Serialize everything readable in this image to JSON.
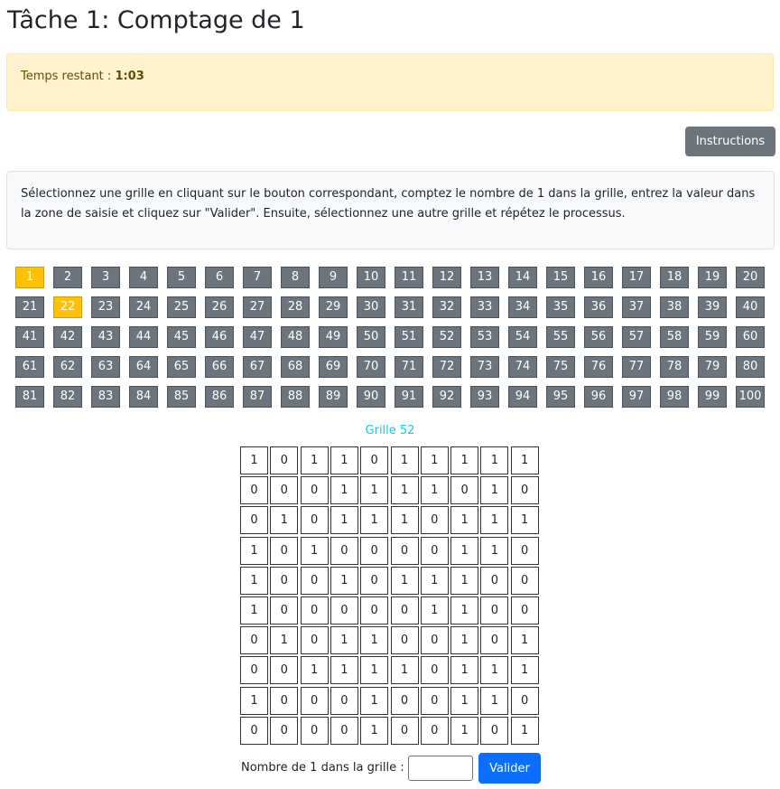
{
  "page_title": "Tâche 1: Comptage de 1",
  "timer": {
    "label": "Temps restant : ",
    "value": "1:03"
  },
  "instructions_button": "Instructions",
  "description": "Sélectionnez une grille en cliquant sur le bouton correspondant, comptez le nombre de 1 dans la grille, entrez la valeur dans la zone de saisie et cliquez sur \"Valider\". Ensuite, sélectionnez une autre grille et répétez le processus.",
  "grid_selector": {
    "buttons": [
      "1",
      "2",
      "3",
      "4",
      "5",
      "6",
      "7",
      "8",
      "9",
      "10",
      "11",
      "12",
      "13",
      "14",
      "15",
      "16",
      "17",
      "18",
      "19",
      "20",
      "21",
      "22",
      "23",
      "24",
      "25",
      "26",
      "27",
      "28",
      "29",
      "30",
      "31",
      "32",
      "33",
      "34",
      "35",
      "36",
      "37",
      "38",
      "39",
      "40",
      "41",
      "42",
      "43",
      "44",
      "45",
      "46",
      "47",
      "48",
      "49",
      "50",
      "51",
      "52",
      "53",
      "54",
      "55",
      "56",
      "57",
      "58",
      "59",
      "60",
      "61",
      "62",
      "63",
      "64",
      "65",
      "66",
      "67",
      "68",
      "69",
      "70",
      "71",
      "72",
      "73",
      "74",
      "75",
      "76",
      "77",
      "78",
      "79",
      "80",
      "81",
      "82",
      "83",
      "84",
      "85",
      "86",
      "87",
      "88",
      "89",
      "90",
      "91",
      "92",
      "93",
      "94",
      "95",
      "96",
      "97",
      "98",
      "99",
      "100"
    ],
    "highlighted": [
      "1",
      "22"
    ],
    "colors": {
      "default": "#6c757d",
      "highlighted": "#ffc107"
    }
  },
  "current_grid": {
    "label": "Grille 52",
    "cells": [
      [
        "1",
        "0",
        "1",
        "1",
        "0",
        "1",
        "1",
        "1",
        "1",
        "1"
      ],
      [
        "0",
        "0",
        "0",
        "1",
        "1",
        "1",
        "1",
        "0",
        "1",
        "0"
      ],
      [
        "0",
        "1",
        "0",
        "1",
        "1",
        "1",
        "0",
        "1",
        "1",
        "1"
      ],
      [
        "1",
        "0",
        "1",
        "0",
        "0",
        "0",
        "0",
        "1",
        "1",
        "0"
      ],
      [
        "1",
        "0",
        "0",
        "1",
        "0",
        "1",
        "1",
        "1",
        "0",
        "0"
      ],
      [
        "1",
        "0",
        "0",
        "0",
        "0",
        "0",
        "1",
        "1",
        "0",
        "0"
      ],
      [
        "0",
        "1",
        "0",
        "1",
        "1",
        "0",
        "0",
        "1",
        "0",
        "1"
      ],
      [
        "0",
        "0",
        "1",
        "1",
        "1",
        "1",
        "0",
        "1",
        "1",
        "1"
      ],
      [
        "1",
        "0",
        "0",
        "0",
        "1",
        "0",
        "0",
        "1",
        "1",
        "0"
      ],
      [
        "0",
        "0",
        "0",
        "0",
        "1",
        "0",
        "0",
        "1",
        "0",
        "1"
      ]
    ]
  },
  "answer": {
    "label": "Nombre de 1 dans la grille :",
    "value": "",
    "placeholder": ""
  },
  "validate_button": "Valider",
  "colors": {
    "primary": "#0d6efd",
    "secondary": "#6c757d",
    "warning_bg": "#fff3cd",
    "warning_text": "#664d03",
    "info": "#0dcaf0"
  }
}
